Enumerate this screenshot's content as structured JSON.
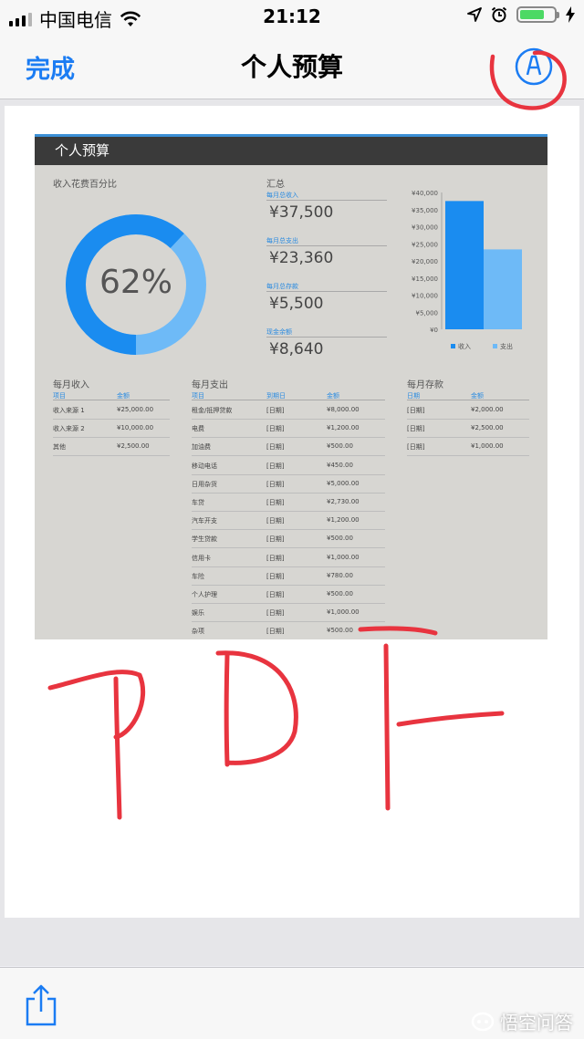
{
  "status_bar": {
    "carrier": "中国电信",
    "time": "21:12",
    "icons": [
      "signal-bars-icon",
      "wifi-icon",
      "location-arrow-icon",
      "alarm-clock-icon",
      "battery-icon",
      "charging-bolt-icon"
    ],
    "battery_color": "#4cd964"
  },
  "nav": {
    "done_label": "完成",
    "title": "个人预算",
    "markup_icon": "markup-pen-icon",
    "accent": "#1b7cf3"
  },
  "doc": {
    "title": "个人预算",
    "percent_label": "收入花费百分比",
    "percent": "62%",
    "percent_value": 0.62,
    "summary": {
      "title": "汇总",
      "items": [
        {
          "label": "每月总收入",
          "value": "¥37,500"
        },
        {
          "label": "每月总支出",
          "value": "¥23,360"
        },
        {
          "label": "每月总存款",
          "value": "¥5,500"
        },
        {
          "label": "现金余额",
          "value": "¥8,640"
        }
      ]
    },
    "income": {
      "title": "每月收入",
      "headers": [
        "项目",
        "金额"
      ],
      "rows": [
        [
          "收入来源 1",
          "¥25,000.00"
        ],
        [
          "收入来源 2",
          "¥10,000.00"
        ],
        [
          "其他",
          "¥2,500.00"
        ]
      ]
    },
    "expenses": {
      "title": "每月支出",
      "headers": [
        "项目",
        "到期日",
        "金额"
      ],
      "rows": [
        [
          "租金/抵押贷款",
          "[日期]",
          "¥8,000.00"
        ],
        [
          "电费",
          "[日期]",
          "¥1,200.00"
        ],
        [
          "加油费",
          "[日期]",
          "¥500.00"
        ],
        [
          "移动电话",
          "[日期]",
          "¥450.00"
        ],
        [
          "日用杂货",
          "[日期]",
          "¥5,000.00"
        ],
        [
          "车贷",
          "[日期]",
          "¥2,730.00"
        ],
        [
          "汽车开支",
          "[日期]",
          "¥1,200.00"
        ],
        [
          "学生贷款",
          "[日期]",
          "¥500.00"
        ],
        [
          "信用卡",
          "[日期]",
          "¥1,000.00"
        ],
        [
          "车险",
          "[日期]",
          "¥780.00"
        ],
        [
          "个人护理",
          "[日期]",
          "¥500.00"
        ],
        [
          "娱乐",
          "[日期]",
          "¥1,000.00"
        ],
        [
          "杂项",
          "[日期]",
          "¥500.00"
        ]
      ]
    },
    "savings": {
      "title": "每月存款",
      "headers": [
        "日期",
        "金额"
      ],
      "rows": [
        [
          "[日期]",
          "¥2,000.00"
        ],
        [
          "[日期]",
          "¥2,500.00"
        ],
        [
          "[日期]",
          "¥1,000.00"
        ]
      ]
    },
    "colors": {
      "income": "#1a8cf0",
      "expense": "#6ebaf7",
      "header_bar": "#3a3a3a",
      "page_bg": "#d7d6d2"
    }
  },
  "chart_data": {
    "type": "bar",
    "categories": [
      "收入",
      "支出"
    ],
    "values": [
      37500,
      23360
    ],
    "ylim": [
      0,
      40000
    ],
    "yticks": [
      "¥0",
      "¥5,000",
      "¥10,000",
      "¥15,000",
      "¥20,000",
      "¥25,000",
      "¥30,000",
      "¥35,000",
      "¥40,000"
    ],
    "legend": [
      "收入",
      "支出"
    ],
    "legend_position": "bottom",
    "colors": [
      "#1a8cf0",
      "#6ebaf7"
    ]
  },
  "annotation": {
    "handwritten_text": "PDF",
    "ink_color": "#e8343f"
  },
  "bottom_bar": {
    "share_icon": "share-icon",
    "watermark": "悟空问答"
  }
}
